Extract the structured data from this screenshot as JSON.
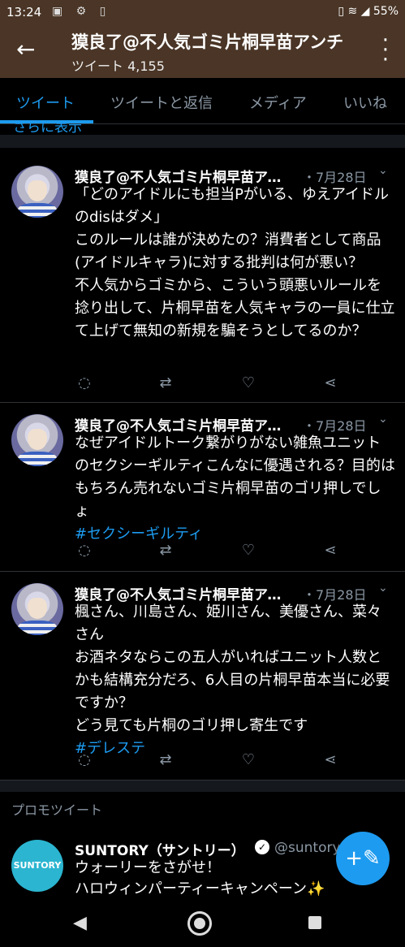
{
  "status": {
    "time": "13:24",
    "battery": "55%",
    "left_icons": "▣ ⚙ ▯",
    "right_icons": "▯ ≋ ◢"
  },
  "header": {
    "title": "獏良了@不人気ゴミ片桐早苗アンチ",
    "subtitle": "ツイート 4,155"
  },
  "tabs": [
    "ツイート",
    "ツイートと返信",
    "メディア",
    "いいね"
  ],
  "show_more": "さらに表示",
  "tweets": [
    {
      "name": "獏良了@不人気ゴミ片桐早苗アンチ",
      "date": "・7月28日",
      "text": "「どのアイドルにも担当Pがいる、ゆえアイドルのdisはダメ」\nこのルールは誰が決めたの？消費者として商品(アイドルキャラ)に対する批判は何が悪い？\n不人気からゴミから、こういう頭悪いルールを捻り出して、片桐早苗を人気キャラの一員に仕立て上げて無知の新規を騙そうとしてるのか？",
      "hashtag": ""
    },
    {
      "name": "獏良了@不人気ゴミ片桐早苗アンチ",
      "date": "・7月28日",
      "text": "なぜアイドルトーク繋がりがない雑魚ユニットのセクシーギルティこんなに優遇される？目的はもちろん売れないゴミ片桐早苗のゴリ押しでしょ",
      "hashtag": "#セクシーギルティ"
    },
    {
      "name": "獏良了@不人気ゴミ片桐早苗アンチ",
      "date": "・7月28日",
      "text": "楓さん、川島さん、姫川さん、美優さん、菜々さん\nお酒ネタならこの五人がいればユニット人数とかも結構充分だろ、6人目の片桐早苗本当に必要ですか？\nどう見ても片桐のゴリ押し寄生です",
      "hashtag": "#デレステ"
    }
  ],
  "icons": {
    "reply": "reply-icon",
    "retweet": "retweet-icon",
    "like": "heart-icon",
    "share": "share-icon"
  },
  "promo": {
    "label": "プロモツイート",
    "avatar_text": "SUNTORY",
    "name": "SUNTORY（サントリー）",
    "handle": "@suntory",
    "text": "ウォーリーをさがせ！\nハロウィンパーティーキャンペーン✨"
  },
  "colors": {
    "accent": "#1d9bf0",
    "header_bg": "#4a3526",
    "muted": "#8b98a5"
  }
}
